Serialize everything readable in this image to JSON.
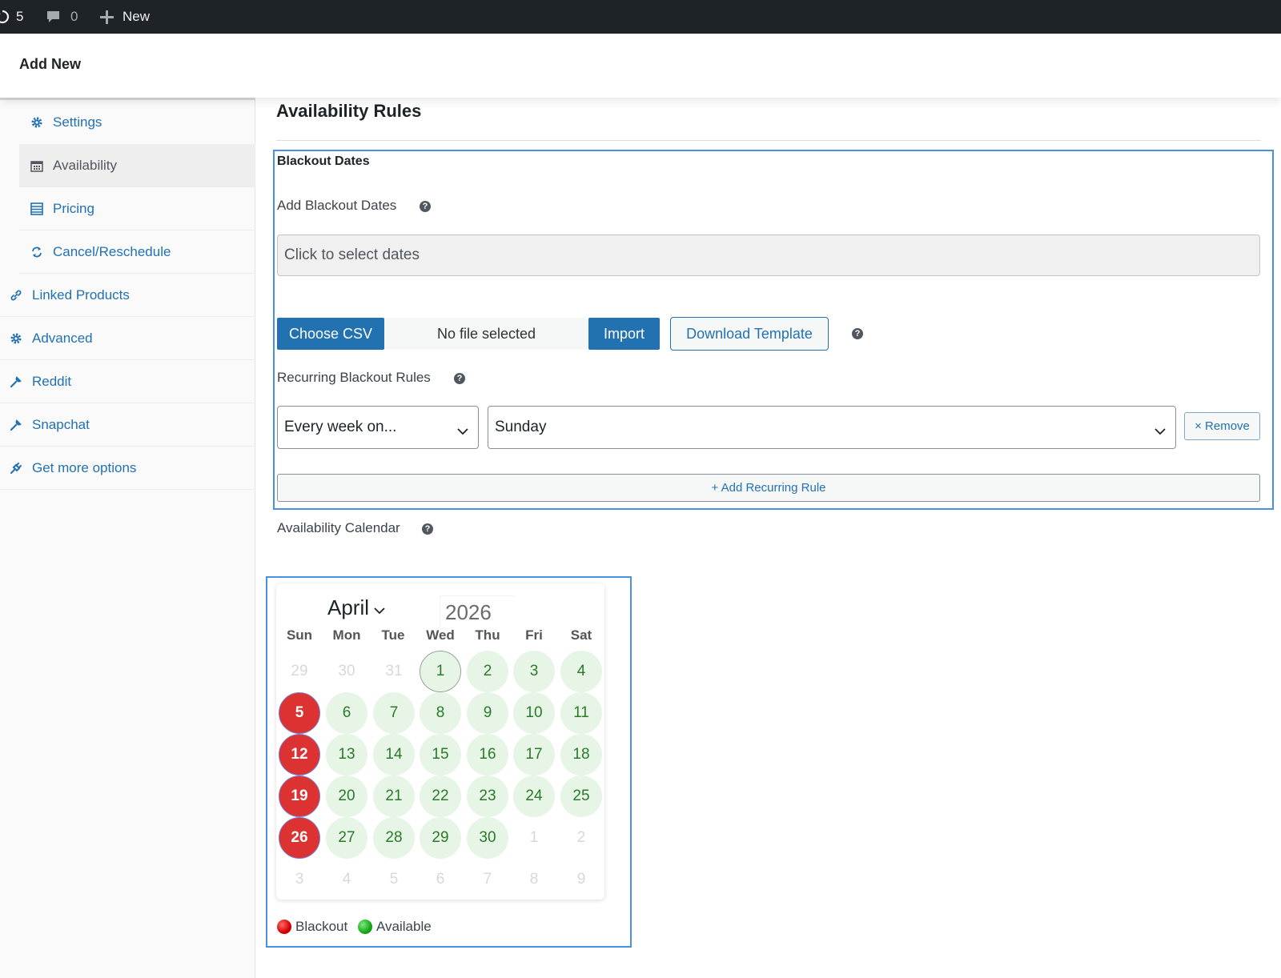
{
  "adminbar": {
    "updates_count": "5",
    "comments_count": "0",
    "new_label": "New",
    "icons": [
      "updates-icon",
      "comments-icon",
      "plus-icon"
    ]
  },
  "header": {
    "title": "Add New"
  },
  "sidebar": {
    "items": [
      {
        "label": "Settings",
        "icon": "gear-icon"
      },
      {
        "label": "Availability",
        "icon": "calendar-icon"
      },
      {
        "label": "Pricing",
        "icon": "list-icon"
      },
      {
        "label": "Cancel/Reschedule",
        "icon": "refresh-icon"
      },
      {
        "label": "Linked Products",
        "icon": "link-icon"
      },
      {
        "label": "Advanced",
        "icon": "gear-icon"
      },
      {
        "label": "Reddit",
        "icon": "wrench-icon"
      },
      {
        "label": "Snapchat",
        "icon": "wrench-icon"
      },
      {
        "label": "Get more options",
        "icon": "plug-icon"
      }
    ]
  },
  "main": {
    "heading": "Availability Rules",
    "blackout": {
      "section_title": "Blackout Dates",
      "add_label": "Add Blackout Dates",
      "date_placeholder": "Click to select dates",
      "choose_csv": "Choose CSV",
      "file_status": "No file selected",
      "import": "Import",
      "download_template": "Download Template",
      "recurring_label": "Recurring Blackout Rules",
      "rule_frequency": "Every week on...",
      "rule_day": "Sunday",
      "remove": "× Remove",
      "add_rule": "+ Add Recurring Rule"
    },
    "calendar": {
      "label": "Availability Calendar",
      "month": "April",
      "year": "2026",
      "weekdays": [
        "Sun",
        "Mon",
        "Tue",
        "Wed",
        "Thu",
        "Fri",
        "Sat"
      ],
      "days": [
        [
          "29",
          "30",
          "31",
          "1",
          "2",
          "3",
          "4"
        ],
        [
          "5",
          "6",
          "7",
          "8",
          "9",
          "10",
          "11"
        ],
        [
          "12",
          "13",
          "14",
          "15",
          "16",
          "17",
          "18"
        ],
        [
          "19",
          "20",
          "21",
          "22",
          "23",
          "24",
          "25"
        ],
        [
          "26",
          "27",
          "28",
          "29",
          "30",
          "1",
          "2"
        ],
        [
          "3",
          "4",
          "5",
          "6",
          "7",
          "8",
          "9"
        ]
      ],
      "blackout_days": [
        "5",
        "12",
        "19",
        "26"
      ],
      "today": "1",
      "legend": {
        "blackout": "Blackout",
        "available": "Available"
      },
      "colors": {
        "blackout": "#dc3232",
        "available": "#e6f5e6",
        "available_text": "#2a7a2a"
      }
    }
  }
}
